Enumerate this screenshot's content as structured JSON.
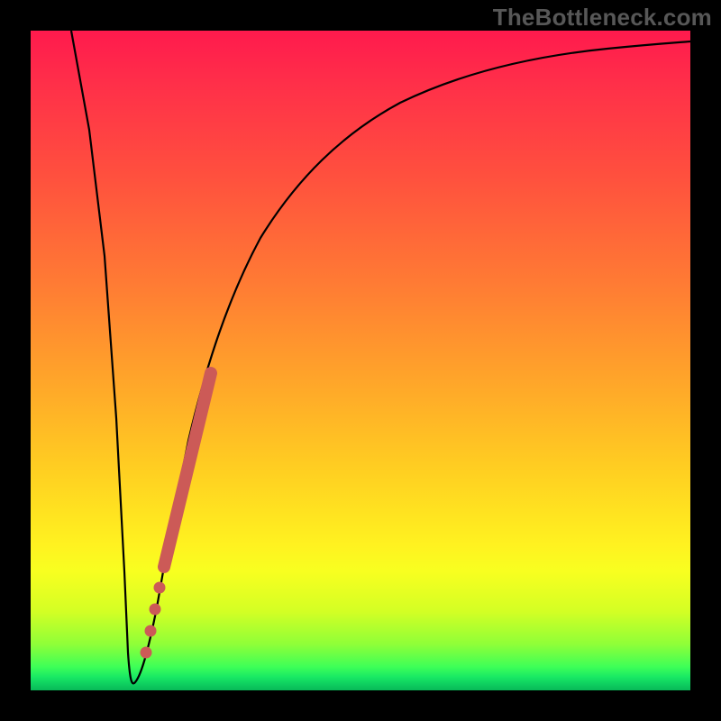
{
  "watermark": "TheBottleneck.com",
  "colors": {
    "background": "#000000",
    "curve": "#000000",
    "marker": "#cc5a57",
    "gradient_top": "#ff1a4d",
    "gradient_mid": "#ffd021",
    "gradient_bottom": "#08b957"
  },
  "chart_data": {
    "type": "line",
    "title": "",
    "xlabel": "",
    "ylabel": "",
    "xlim": [
      0,
      100
    ],
    "ylim": [
      0,
      100
    ],
    "series": [
      {
        "name": "bottleneck-curve",
        "x": [
          0,
          3,
          6,
          9,
          12,
          13.5,
          15,
          17,
          20,
          24,
          28,
          32,
          38,
          45,
          55,
          65,
          75,
          85,
          95,
          100
        ],
        "y": [
          100,
          80,
          60,
          40,
          20,
          3,
          2,
          10,
          28,
          45,
          58,
          67,
          76,
          83,
          89,
          92.5,
          95,
          96.5,
          97.5,
          98
        ]
      }
    ],
    "markers": {
      "name": "highlight-segment",
      "points": [
        {
          "x": 18.0,
          "y": 13
        },
        {
          "x": 18.8,
          "y": 18
        },
        {
          "x": 19.6,
          "y": 23
        },
        {
          "x": 20.4,
          "y": 28
        },
        {
          "x": 21.2,
          "y": 33
        },
        {
          "x": 22.0,
          "y": 37
        },
        {
          "x": 22.8,
          "y": 41
        },
        {
          "x": 23.6,
          "y": 45
        },
        {
          "x": 24.4,
          "y": 48
        },
        {
          "x": 25.2,
          "y": 51
        }
      ],
      "gap_points": [
        {
          "x": 16.0,
          "y": 5
        },
        {
          "x": 16.6,
          "y": 7
        },
        {
          "x": 17.2,
          "y": 9
        }
      ]
    }
  }
}
